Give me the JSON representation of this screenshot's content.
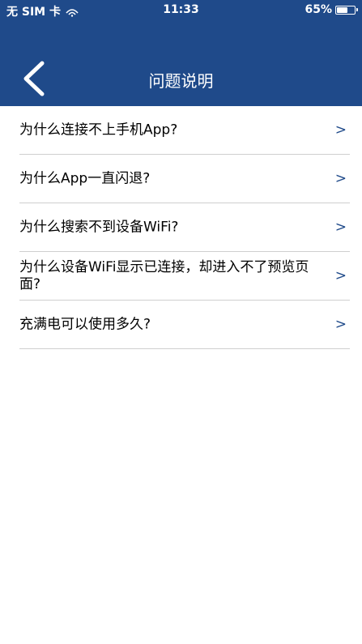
{
  "status_bar": {
    "carrier": "无 SIM 卡",
    "time": "11:33",
    "battery_percent": "65%",
    "battery_level": 0.65
  },
  "nav": {
    "back_icon": "chevron-left-icon",
    "title": "问题说明"
  },
  "faq": {
    "items": [
      {
        "question": "为什么连接不上手机App?",
        "arrow": ">"
      },
      {
        "question": "为什么App一直闪退?",
        "arrow": ">"
      },
      {
        "question": "为什么搜索不到设备WiFi?",
        "arrow": ">"
      },
      {
        "question": "为什么设备WiFi显示已连接，却进入不了预览页面?",
        "arrow": ">"
      },
      {
        "question": "充满电可以使用多久?",
        "arrow": ">"
      }
    ]
  },
  "colors": {
    "header_bg": "#1f4a8a",
    "arrow": "#1f4a8a",
    "divider": "#cfcfcf"
  }
}
